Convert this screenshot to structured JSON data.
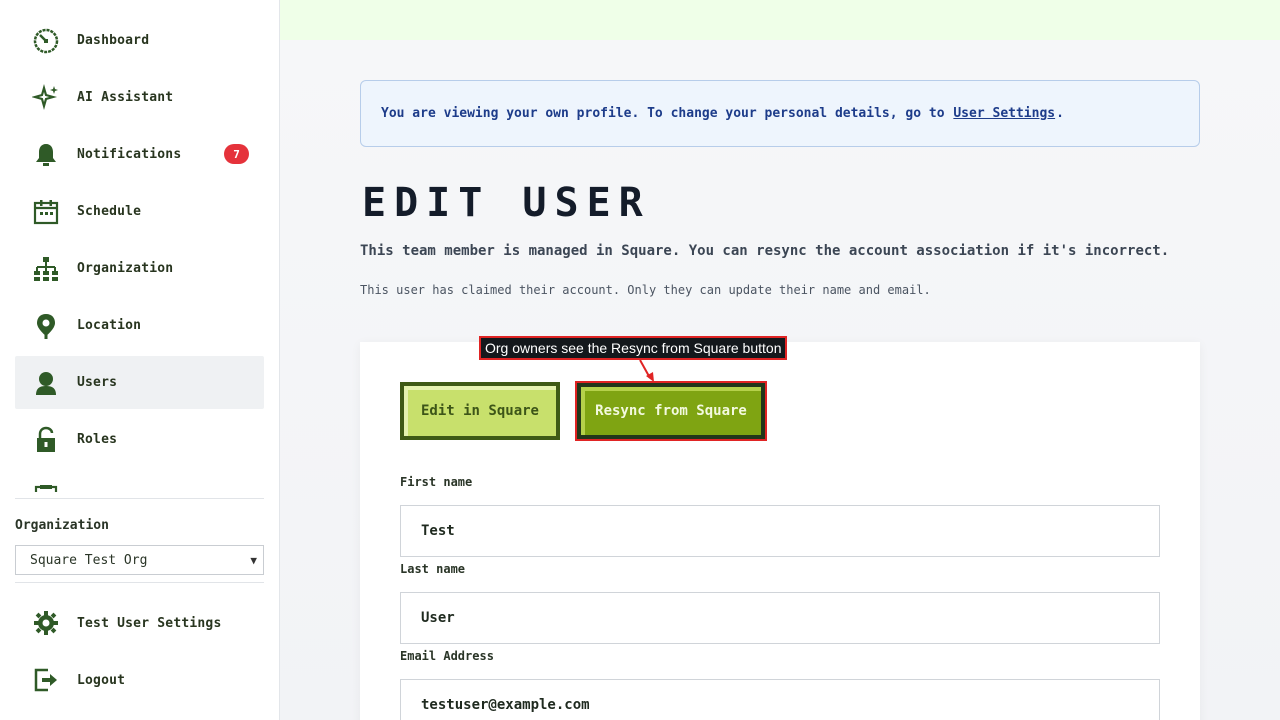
{
  "sidebar": {
    "items": [
      {
        "label": "Dashboard",
        "icon": "dashboard-icon"
      },
      {
        "label": "AI Assistant",
        "icon": "sparkle-icon"
      },
      {
        "label": "Notifications",
        "icon": "bell-icon",
        "badge": "7"
      },
      {
        "label": "Schedule",
        "icon": "calendar-icon"
      },
      {
        "label": "Organization",
        "icon": "org-chart-icon"
      },
      {
        "label": "Location",
        "icon": "location-pin-icon"
      },
      {
        "label": "Users",
        "icon": "user-icon",
        "active": true
      },
      {
        "label": "Roles",
        "icon": "lock-icon"
      }
    ],
    "org_label": "Organization",
    "org_selected": "Square Test Org",
    "settings_label": "Test User Settings",
    "logout_label": "Logout"
  },
  "info": {
    "text_before": "You are viewing your own profile. To change your personal details, go to",
    "link": "User Settings",
    "text_after": "."
  },
  "page": {
    "title": "EDIT USER",
    "subtitle": "This team member is managed in Square. You can resync the account association if it's incorrect.",
    "note": "This user has claimed their account. Only they can update their name and email."
  },
  "buttons": {
    "edit_square": "Edit in Square",
    "resync_square": "Resync from Square"
  },
  "annotation": "Org owners see the Resync from Square button",
  "form": {
    "first_name_label": "First name",
    "first_name_value": "Test",
    "last_name_label": "Last name",
    "last_name_value": "User",
    "email_label": "Email Address",
    "email_value": "testuser@example.com"
  },
  "colors": {
    "icon_green": "#2f5a27",
    "badge_red": "#e5323b",
    "button_light": "#c8e06c",
    "button_dark": "#7fa412",
    "annotation_red": "#e02424"
  }
}
